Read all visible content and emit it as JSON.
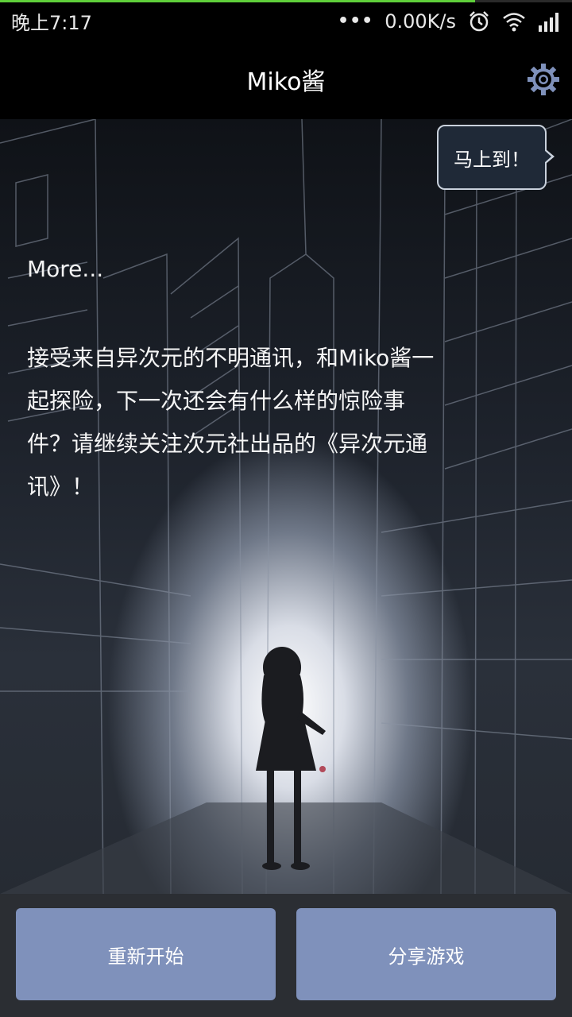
{
  "status_bar": {
    "time": "晚上7:17",
    "dots": "•••",
    "net_speed": "0.00K/s",
    "icons": [
      "alarm-icon",
      "wifi-icon",
      "signal-icon"
    ]
  },
  "progress": {
    "fraction": 0.83,
    "color": "#5fcf3a"
  },
  "header": {
    "title": "Miko酱",
    "settings_icon": "gear-icon",
    "accent": "#7f91bb"
  },
  "scene": {
    "bubble": "马上到！",
    "more": "More...",
    "story": "接受来自异次元的不明通讯，和Miko酱一起探险，下一次还会有什么样的惊险事件？请继续关注次元社出品的《异次元通讯》！"
  },
  "actions": {
    "restart_label": "重新开始",
    "share_label": "分享游戏",
    "button_color": "#7f91bb"
  }
}
